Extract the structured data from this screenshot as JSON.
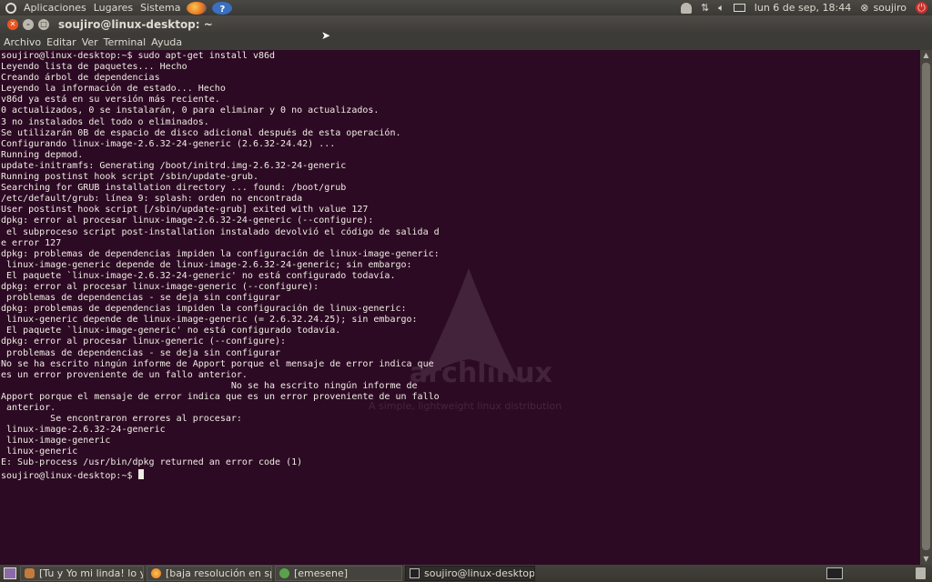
{
  "top_panel": {
    "menus": [
      "Aplicaciones",
      "Lugares",
      "Sistema"
    ],
    "datetime": "lun  6 de sep, 18:44",
    "user": "soujiro"
  },
  "window": {
    "title": "soujiro@linux-desktop: ~",
    "menu": [
      "Archivo",
      "Editar",
      "Ver",
      "Terminal",
      "Ayuda"
    ]
  },
  "wallpaper": {
    "logo_text": "archlinux",
    "tagline": "A simple, lightweight linux distribution"
  },
  "terminal": {
    "lines": [
      "soujiro@linux-desktop:~$ sudo apt-get install v86d",
      "Leyendo lista de paquetes... Hecho",
      "Creando árbol de dependencias",
      "Leyendo la información de estado... Hecho",
      "v86d ya está en su versión más reciente.",
      "0 actualizados, 0 se instalarán, 0 para eliminar y 0 no actualizados.",
      "3 no instalados del todo o eliminados.",
      "Se utilizarán 0B de espacio de disco adicional después de esta operación.",
      "Configurando linux-image-2.6.32-24-generic (2.6.32-24.42) ...",
      "Running depmod.",
      "update-initramfs: Generating /boot/initrd.img-2.6.32-24-generic",
      "Running postinst hook script /sbin/update-grub.",
      "Searching for GRUB installation directory ... found: /boot/grub",
      "/etc/default/grub: línea 9: splash: orden no encontrada",
      "User postinst hook script [/sbin/update-grub] exited with value 127",
      "dpkg: error al procesar linux-image-2.6.32-24-generic (--configure):",
      " el subproceso script post-installation instalado devolvió el código de salida d",
      "e error 127",
      "dpkg: problemas de dependencias impiden la configuración de linux-image-generic:",
      " linux-image-generic depende de linux-image-2.6.32-24-generic; sin embargo:",
      " El paquete `linux-image-2.6.32-24-generic' no está configurado todavía.",
      "dpkg: error al procesar linux-image-generic (--configure):",
      " problemas de dependencias - se deja sin configurar",
      "dpkg: problemas de dependencias impiden la configuración de linux-generic:",
      " linux-generic depende de linux-image-generic (= 2.6.32.24.25); sin embargo:",
      " El paquete `linux-image-generic' no está configurado todavía.",
      "dpkg: error al procesar linux-generic (--configure):",
      " problemas de dependencias - se deja sin configurar",
      "No se ha escrito ningún informe de Apport porque el mensaje de error indica que",
      "es un error proveniente de un fallo anterior.",
      "                                          No se ha escrito ningún informe de",
      "Apport porque el mensaje de error indica que es un error proveniente de un fallo",
      " anterior.",
      "         Se encontraron errores al procesar:",
      " linux-image-2.6.32-24-generic",
      " linux-image-generic",
      " linux-generic",
      "E: Sub-process /usr/bin/dpkg returned an error code (1)"
    ],
    "prompt": "soujiro@linux-desktop:~$ "
  },
  "taskbar": {
    "tasks": [
      {
        "label": "[Tu y Yo mi linda! lo yu...",
        "icon": "person-icon",
        "active": false
      },
      {
        "label": "[baja resolución en spl...",
        "icon": "firefox-icon",
        "active": false
      },
      {
        "label": "[emesene]",
        "icon": "emesene-icon",
        "active": false
      },
      {
        "label": "soujiro@linux-desktop: ~",
        "icon": "terminal-icon",
        "active": true
      }
    ]
  },
  "colors": {
    "terminal_bg": "#2c0a23",
    "terminal_fg": "#f0ece4",
    "panel_bg": "#3c3b37",
    "close_button": "#e95420"
  }
}
